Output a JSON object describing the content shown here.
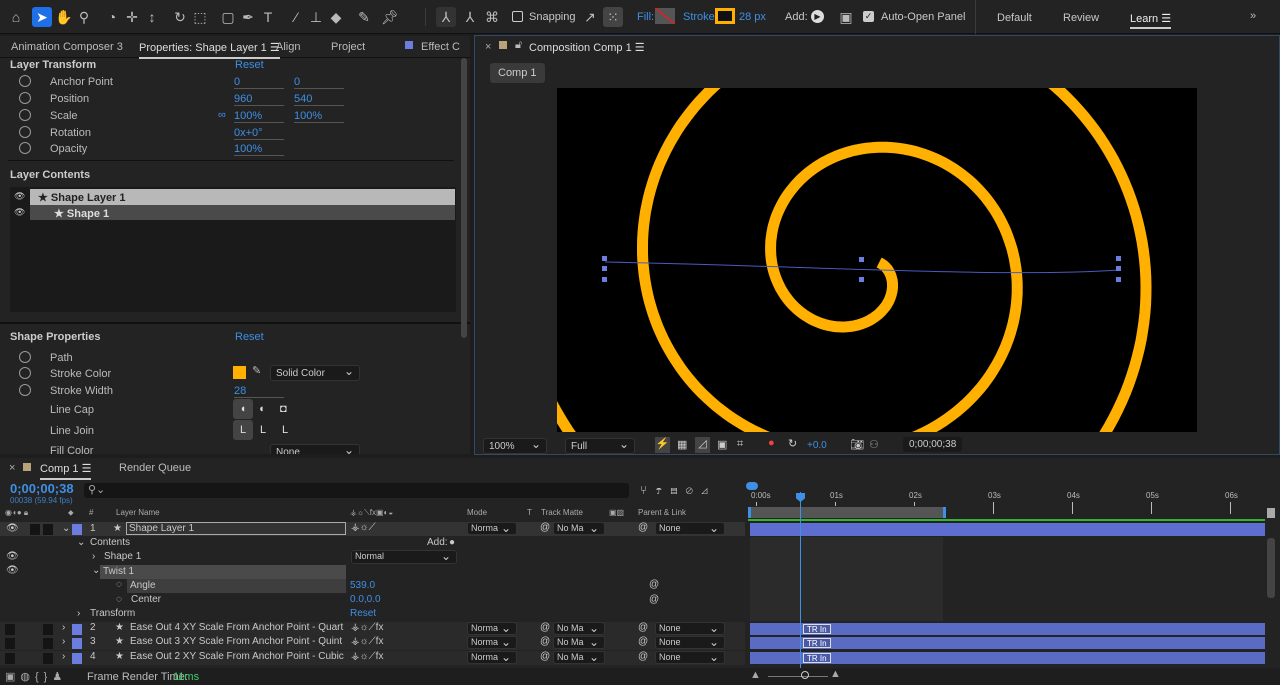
{
  "toolbar": {
    "snapping": "Snapping",
    "fill": "Fill:",
    "stroke": "Stroke:",
    "stroke_px": "28 px",
    "add": "Add:",
    "auto_open": "Auto-Open Panel",
    "workspaces": [
      "Default",
      "Review",
      "Learn"
    ],
    "more": "»"
  },
  "left_tabs": [
    "Animation Composer 3",
    "Properties: Shape Layer 1",
    "Align",
    "Project",
    "Effect C"
  ],
  "layer_transform": {
    "title": "Layer Transform",
    "reset": "Reset",
    "props": [
      {
        "label": "Anchor Point",
        "v1": "0",
        "v2": "0"
      },
      {
        "label": "Position",
        "v1": "960",
        "v2": "540"
      },
      {
        "label": "Scale",
        "v1": "100%",
        "v2": "100%"
      },
      {
        "label": "Rotation",
        "v1": "0x+0°",
        "v2": ""
      },
      {
        "label": "Opacity",
        "v1": "100%",
        "v2": ""
      }
    ]
  },
  "layer_contents": {
    "title": "Layer Contents",
    "items": [
      "Shape Layer 1",
      "Shape 1"
    ]
  },
  "shape_props": {
    "title": "Shape Properties",
    "reset": "Reset",
    "path": "Path",
    "stroke_color": "Stroke Color",
    "color_mode": "Solid Color",
    "stroke_width": "Stroke Width",
    "stroke_width_val": "28",
    "line_cap": "Line Cap",
    "line_join": "Line Join",
    "fill_color": "Fill Color",
    "fill_mode": "None",
    "stroke_hex": "#FFB000"
  },
  "comp": {
    "tab": "Composition Comp 1",
    "crumb": "Comp 1",
    "zoom": "100%",
    "quality": "Full",
    "exposure": "+0.0",
    "timecode": "0;00;00;38"
  },
  "timeline": {
    "tab": "Comp 1",
    "render_queue": "Render Queue",
    "timecode": "0;00;00;38",
    "frame_info": "00038 (59.94 fps)",
    "cols": {
      "num": "#",
      "name": "Layer Name",
      "mode": "Mode",
      "t": "T",
      "matte": "Track Matte",
      "parent": "Parent & Link"
    },
    "ruler": [
      "0:00s",
      "01s",
      "02s",
      "03s",
      "04s",
      "05s",
      "06s"
    ],
    "layer1": {
      "num": "1",
      "name": "Shape Layer 1",
      "mode": "Norma",
      "matte": "No Ma",
      "parent": "None"
    },
    "contents": "Contents",
    "add": "Add:",
    "shape1": "Shape 1",
    "shape1_mode": "Normal",
    "twist": "Twist 1",
    "angle": "Angle",
    "angle_val": "539.0",
    "center": "Center",
    "center_val": "0.0,0.0",
    "transform": "Transform",
    "reset": "Reset",
    "layers": [
      {
        "num": "2",
        "name": "Ease Out 4 XY Scale From Anchor Point - Quart",
        "mode": "Norma",
        "matte": "No Ma",
        "parent": "None",
        "badge": "TR In"
      },
      {
        "num": "3",
        "name": "Ease Out 3 XY Scale From Anchor Point - Quint",
        "mode": "Norma",
        "matte": "No Ma",
        "parent": "None",
        "badge": "TR In"
      },
      {
        "num": "4",
        "name": "Ease Out 2 XY Scale From Anchor Point - Cubic",
        "mode": "Norma",
        "matte": "No Ma",
        "parent": "None",
        "badge": "TR In"
      }
    ],
    "render_label": "Frame Render Time:",
    "render_val": "11ms"
  }
}
